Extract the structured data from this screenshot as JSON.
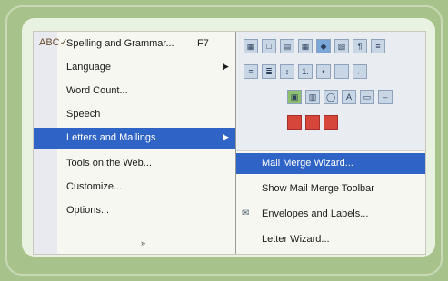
{
  "tools_menu": {
    "items": [
      {
        "label": "Spelling and Grammar...",
        "shortcut": "F7",
        "has_submenu": false
      },
      {
        "label": "Language",
        "shortcut": "",
        "has_submenu": true
      },
      {
        "label": "Word Count...",
        "shortcut": "",
        "has_submenu": false
      },
      {
        "label": "Speech",
        "shortcut": "",
        "has_submenu": false
      },
      {
        "label": "Letters and Mailings",
        "shortcut": "",
        "has_submenu": true,
        "active": true
      },
      {
        "label": "Tools on the Web...",
        "shortcut": "",
        "has_submenu": false
      },
      {
        "label": "Customize...",
        "shortcut": "",
        "has_submenu": false
      },
      {
        "label": "Options...",
        "shortcut": "",
        "has_submenu": false
      }
    ],
    "more_glyph": "»"
  },
  "submenu": {
    "items": [
      {
        "label": "Mail Merge Wizard...",
        "active": true
      },
      {
        "label": "Show Mail Merge Toolbar"
      },
      {
        "label": "Envelopes and Labels..."
      },
      {
        "label": "Letter Wizard..."
      }
    ]
  },
  "toolbar": {
    "row1": [
      "grid-icon",
      "window-icon",
      "columns-icon",
      "table-icon",
      "chart-icon",
      "map-icon",
      "paragraph-icon",
      "format-icon"
    ],
    "row2": [
      "align-left-icon",
      "align-center-icon",
      "line-spacing-icon",
      "numbering-icon",
      "bullets-icon",
      "indent-icon",
      "outdent-icon"
    ],
    "row3": [
      "picture-icon",
      "chart-bar-icon",
      "shape-icon",
      "wordart-icon",
      "textbox-icon",
      "dash-icon"
    ],
    "row4": [
      "red-icon-1",
      "red-icon-2",
      "red-icon-3"
    ]
  },
  "colors": {
    "highlight": "#2f64c6",
    "frame": "#a8c28c"
  }
}
